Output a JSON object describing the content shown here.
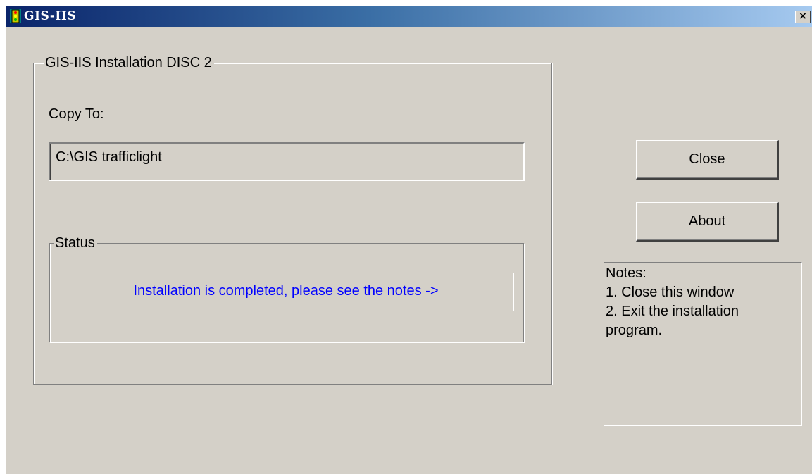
{
  "window": {
    "title": "GIS-IIS",
    "close_glyph": "×"
  },
  "install_group": {
    "legend": "GIS-IIS Installation DISC 2",
    "copy_to_label": "Copy To:",
    "copy_to_value": "C:\\GIS trafficlight"
  },
  "status_group": {
    "legend": "Status",
    "message": "Installation is completed, please see the notes ->",
    "message_color": "#0000ff"
  },
  "buttons": {
    "close_label": "Close",
    "about_label": "About"
  },
  "notes": {
    "lines": [
      "Notes:",
      "1. Close this window",
      "2. Exit the installation",
      "program."
    ]
  },
  "colors": {
    "title_gradient_start": "#0a246a",
    "title_gradient_end": "#a6caf0",
    "window_bg": "#d4d0c8"
  },
  "icons": {
    "app": "traffic-light-icon",
    "close": "close-icon"
  }
}
